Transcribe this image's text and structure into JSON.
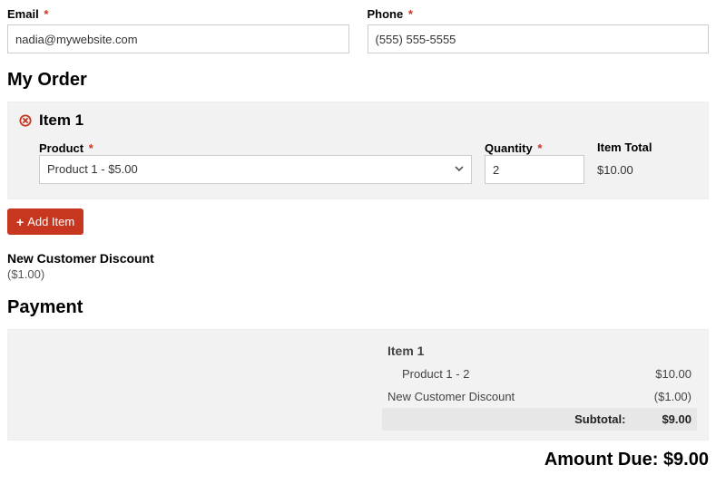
{
  "contact": {
    "email_label": "Email",
    "email_value": "nadia@mywebsite.com",
    "phone_label": "Phone",
    "phone_value": "(555) 555-5555"
  },
  "order": {
    "heading": "My Order",
    "item": {
      "title": "Item 1",
      "product_label": "Product",
      "product_selected": "Product 1 - $5.00",
      "quantity_label": "Quantity",
      "quantity_value": "2",
      "item_total_label": "Item Total",
      "item_total_value": "$10.00"
    },
    "add_item_label": "Add Item"
  },
  "discount": {
    "title": "New Customer Discount",
    "amount": "($1.00)"
  },
  "payment": {
    "heading": "Payment",
    "summary": {
      "item_heading": "Item 1",
      "line_item_label": "Product 1 - 2",
      "line_item_amount": "$10.00",
      "discount_label": "New Customer Discount",
      "discount_amount": "($1.00)",
      "subtotal_label": "Subtotal:",
      "subtotal_amount": "$9.00"
    },
    "amount_due_label": "Amount Due:",
    "amount_due_value": "$9.00"
  },
  "colors": {
    "accent": "#c7361f",
    "panel_bg": "#f2f2f2"
  }
}
